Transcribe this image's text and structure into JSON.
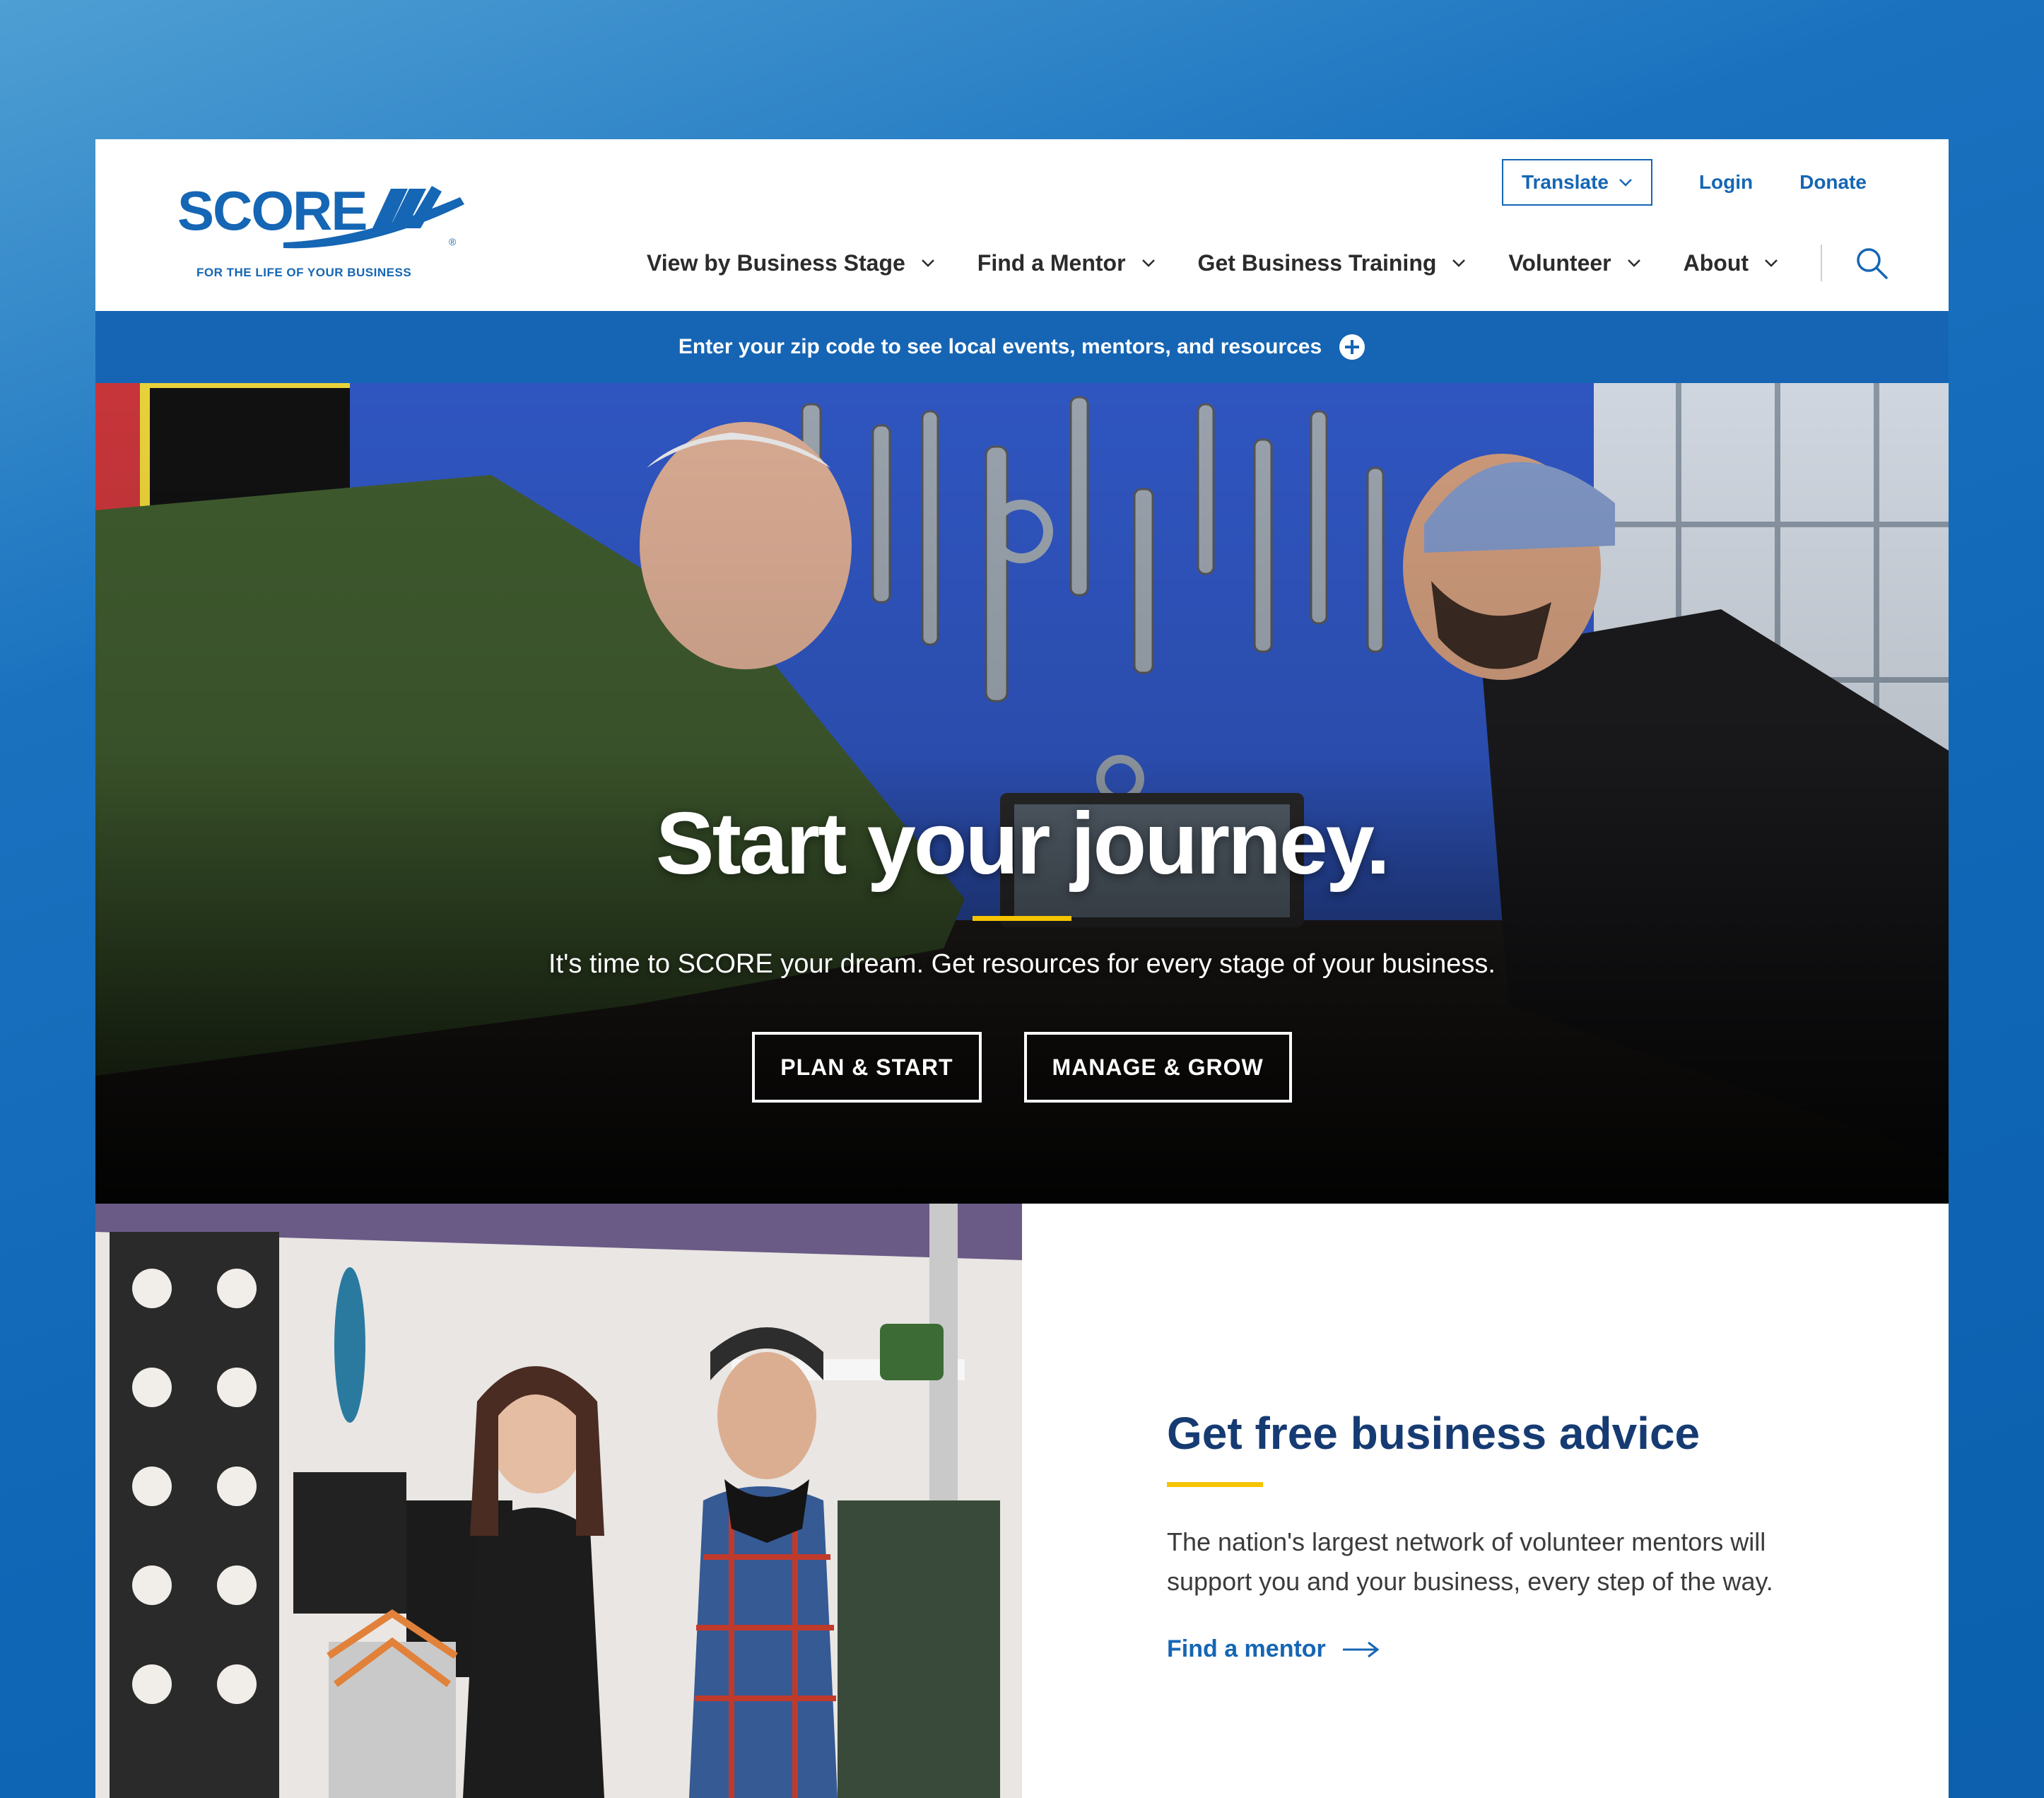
{
  "logo": {
    "wordmark": "SCORE",
    "tagline": "FOR THE LIFE OF YOUR BUSINESS",
    "registered": "®"
  },
  "utility": {
    "translate_label": "Translate",
    "login_label": "Login",
    "donate_label": "Donate"
  },
  "nav": {
    "items": [
      {
        "label": "View by Business Stage"
      },
      {
        "label": "Find a Mentor"
      },
      {
        "label": "Get Business Training"
      },
      {
        "label": "Volunteer"
      },
      {
        "label": "About"
      }
    ]
  },
  "zipbar": {
    "text": "Enter your zip code to see local events, mentors, and resources"
  },
  "hero": {
    "title": "Start your journey.",
    "subtitle": "It's time to SCORE your dream. Get resources for every stage of your business.",
    "buttons": [
      {
        "label": "PLAN & START"
      },
      {
        "label": "MANAGE & GROW"
      }
    ]
  },
  "advice": {
    "title": "Get free business advice",
    "body": "The nation's largest network of volunteer mentors will support you and your business, every step of the way.",
    "link_label": "Find a mentor"
  },
  "colors": {
    "brand_blue": "#1566b4",
    "navy": "#163b73",
    "accent_yellow": "#f5c400"
  },
  "icons": [
    "chevron-down-icon",
    "search-icon",
    "plus-circle-icon",
    "arrow-right-icon",
    "score-stripes-icon"
  ]
}
